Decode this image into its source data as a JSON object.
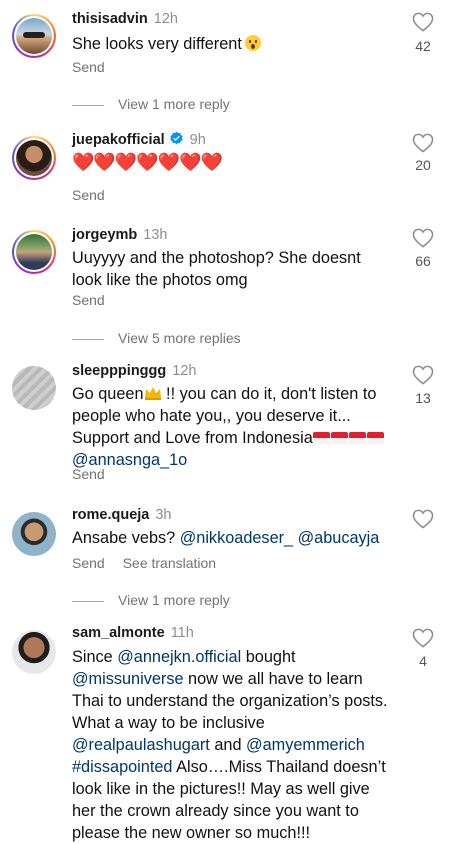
{
  "comments": [
    {
      "username": "thisisadvin",
      "time": "12h",
      "text": "She looks very different",
      "emoji": "hushed-face",
      "likes": "42",
      "send": "Send"
    },
    {
      "username": "juepakofficial",
      "time": "9h",
      "text": "❤️❤️❤️❤️❤️❤️❤️",
      "likes": "20",
      "send": "Send"
    },
    {
      "username": "jorgeymb",
      "time": "13h",
      "text": "Uuyyyy and the photoshop? She doesnt look like the photos omg",
      "likes": "66",
      "send": "Send"
    },
    {
      "username": "sleepppinggg",
      "time": "12h",
      "text_a": "Go queen",
      "text_b": " !! you can do it, don't listen to people who hate you,, you deserve it... Support and Love from Indonesia",
      "mention": "@annasnga_1o",
      "likes": "13",
      "send": "Send"
    },
    {
      "username": "rome.queja",
      "time": "3h",
      "text": "Ansabe vebs?",
      "mention1": "@nikkoadeser_",
      "mention2": "@abucayja",
      "send": "Send",
      "see_translation": "See translation"
    },
    {
      "username": "sam_almonte",
      "time": "11h",
      "likes": "4",
      "t1": "Since ",
      "m1": "@annejkn.official",
      "t2": " bought ",
      "m2": "@missuniverse",
      "t3": " now we all have to learn Thai to understand the organization’s posts. What a way to be inclusive ",
      "m3": "@realpaulashugart",
      "t4": " and ",
      "m4": "@amyemmerich",
      "t5": " ",
      "m5": "#dissapointed",
      "t6": " Also….Miss Thailand doesn’t look like in the pictures!! May as well give her the crown already since you want to please the new owner so much!!!"
    }
  ],
  "view_replies": [
    "View 1 more reply",
    "View 5 more replies",
    "View 1 more reply"
  ],
  "colors": {
    "mention": "#00376b",
    "muted": "#737373",
    "heart_red": "#e0182d",
    "verified": "#0095f6"
  }
}
